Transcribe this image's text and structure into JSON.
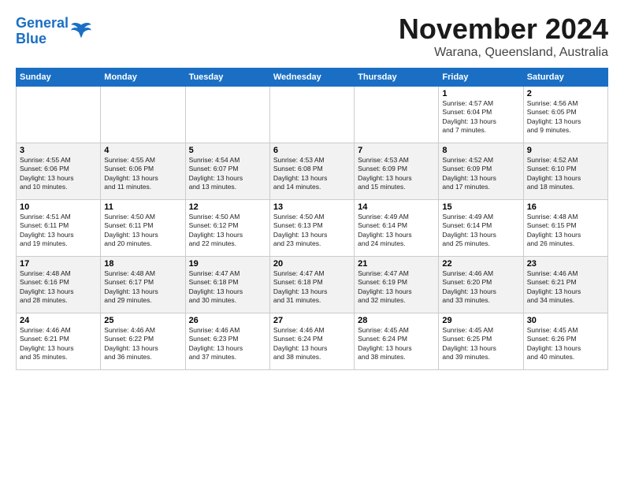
{
  "logo": {
    "line1": "General",
    "line2": "Blue"
  },
  "title": "November 2024",
  "location": "Warana, Queensland, Australia",
  "days_header": [
    "Sunday",
    "Monday",
    "Tuesday",
    "Wednesday",
    "Thursday",
    "Friday",
    "Saturday"
  ],
  "weeks": [
    [
      {
        "num": "",
        "info": ""
      },
      {
        "num": "",
        "info": ""
      },
      {
        "num": "",
        "info": ""
      },
      {
        "num": "",
        "info": ""
      },
      {
        "num": "",
        "info": ""
      },
      {
        "num": "1",
        "info": "Sunrise: 4:57 AM\nSunset: 6:04 PM\nDaylight: 13 hours\nand 7 minutes."
      },
      {
        "num": "2",
        "info": "Sunrise: 4:56 AM\nSunset: 6:05 PM\nDaylight: 13 hours\nand 9 minutes."
      }
    ],
    [
      {
        "num": "3",
        "info": "Sunrise: 4:55 AM\nSunset: 6:06 PM\nDaylight: 13 hours\nand 10 minutes."
      },
      {
        "num": "4",
        "info": "Sunrise: 4:55 AM\nSunset: 6:06 PM\nDaylight: 13 hours\nand 11 minutes."
      },
      {
        "num": "5",
        "info": "Sunrise: 4:54 AM\nSunset: 6:07 PM\nDaylight: 13 hours\nand 13 minutes."
      },
      {
        "num": "6",
        "info": "Sunrise: 4:53 AM\nSunset: 6:08 PM\nDaylight: 13 hours\nand 14 minutes."
      },
      {
        "num": "7",
        "info": "Sunrise: 4:53 AM\nSunset: 6:09 PM\nDaylight: 13 hours\nand 15 minutes."
      },
      {
        "num": "8",
        "info": "Sunrise: 4:52 AM\nSunset: 6:09 PM\nDaylight: 13 hours\nand 17 minutes."
      },
      {
        "num": "9",
        "info": "Sunrise: 4:52 AM\nSunset: 6:10 PM\nDaylight: 13 hours\nand 18 minutes."
      }
    ],
    [
      {
        "num": "10",
        "info": "Sunrise: 4:51 AM\nSunset: 6:11 PM\nDaylight: 13 hours\nand 19 minutes."
      },
      {
        "num": "11",
        "info": "Sunrise: 4:50 AM\nSunset: 6:11 PM\nDaylight: 13 hours\nand 20 minutes."
      },
      {
        "num": "12",
        "info": "Sunrise: 4:50 AM\nSunset: 6:12 PM\nDaylight: 13 hours\nand 22 minutes."
      },
      {
        "num": "13",
        "info": "Sunrise: 4:50 AM\nSunset: 6:13 PM\nDaylight: 13 hours\nand 23 minutes."
      },
      {
        "num": "14",
        "info": "Sunrise: 4:49 AM\nSunset: 6:14 PM\nDaylight: 13 hours\nand 24 minutes."
      },
      {
        "num": "15",
        "info": "Sunrise: 4:49 AM\nSunset: 6:14 PM\nDaylight: 13 hours\nand 25 minutes."
      },
      {
        "num": "16",
        "info": "Sunrise: 4:48 AM\nSunset: 6:15 PM\nDaylight: 13 hours\nand 26 minutes."
      }
    ],
    [
      {
        "num": "17",
        "info": "Sunrise: 4:48 AM\nSunset: 6:16 PM\nDaylight: 13 hours\nand 28 minutes."
      },
      {
        "num": "18",
        "info": "Sunrise: 4:48 AM\nSunset: 6:17 PM\nDaylight: 13 hours\nand 29 minutes."
      },
      {
        "num": "19",
        "info": "Sunrise: 4:47 AM\nSunset: 6:18 PM\nDaylight: 13 hours\nand 30 minutes."
      },
      {
        "num": "20",
        "info": "Sunrise: 4:47 AM\nSunset: 6:18 PM\nDaylight: 13 hours\nand 31 minutes."
      },
      {
        "num": "21",
        "info": "Sunrise: 4:47 AM\nSunset: 6:19 PM\nDaylight: 13 hours\nand 32 minutes."
      },
      {
        "num": "22",
        "info": "Sunrise: 4:46 AM\nSunset: 6:20 PM\nDaylight: 13 hours\nand 33 minutes."
      },
      {
        "num": "23",
        "info": "Sunrise: 4:46 AM\nSunset: 6:21 PM\nDaylight: 13 hours\nand 34 minutes."
      }
    ],
    [
      {
        "num": "24",
        "info": "Sunrise: 4:46 AM\nSunset: 6:21 PM\nDaylight: 13 hours\nand 35 minutes."
      },
      {
        "num": "25",
        "info": "Sunrise: 4:46 AM\nSunset: 6:22 PM\nDaylight: 13 hours\nand 36 minutes."
      },
      {
        "num": "26",
        "info": "Sunrise: 4:46 AM\nSunset: 6:23 PM\nDaylight: 13 hours\nand 37 minutes."
      },
      {
        "num": "27",
        "info": "Sunrise: 4:46 AM\nSunset: 6:24 PM\nDaylight: 13 hours\nand 38 minutes."
      },
      {
        "num": "28",
        "info": "Sunrise: 4:45 AM\nSunset: 6:24 PM\nDaylight: 13 hours\nand 38 minutes."
      },
      {
        "num": "29",
        "info": "Sunrise: 4:45 AM\nSunset: 6:25 PM\nDaylight: 13 hours\nand 39 minutes."
      },
      {
        "num": "30",
        "info": "Sunrise: 4:45 AM\nSunset: 6:26 PM\nDaylight: 13 hours\nand 40 minutes."
      }
    ]
  ]
}
